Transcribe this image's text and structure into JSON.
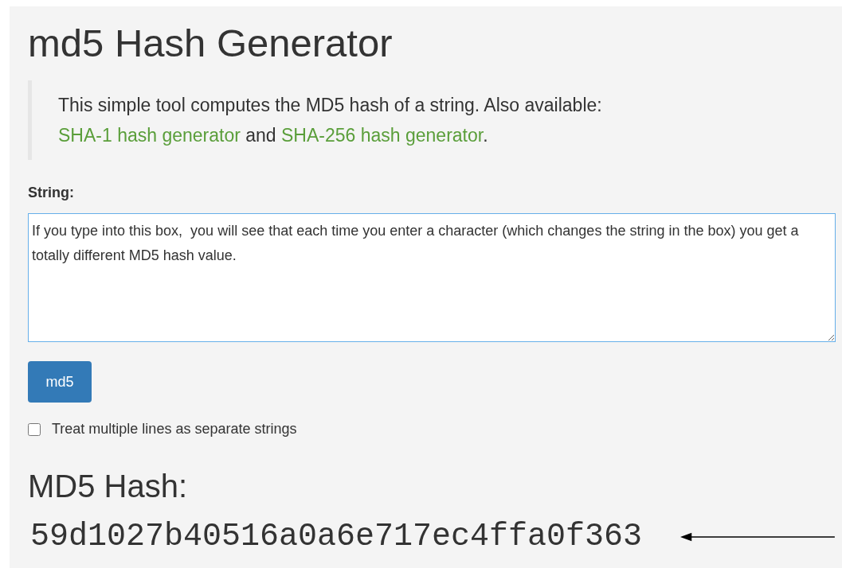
{
  "title": "md5 Hash Generator",
  "description": [
    {
      "kind": "text",
      "text": "This simple tool computes the MD5 hash of a string. Also available: "
    },
    {
      "kind": "link",
      "text": "SHA-1 hash generator"
    },
    {
      "kind": "text",
      "text": " and "
    },
    {
      "kind": "link",
      "text": "SHA-256 hash generator"
    },
    {
      "kind": "text",
      "text": "."
    }
  ],
  "string_field": {
    "label": "String:",
    "value": "If you type into this box,  you will see that each time you enter a character (which changes the string in the box) you get a totally different MD5 hash value."
  },
  "button": "md5",
  "checkbox": {
    "label": "Treat multiple lines as separate strings",
    "checked": false
  },
  "result": {
    "heading": "MD5 Hash:",
    "value": "59d1027b40516a0a6e717ec4ffa0f363"
  }
}
